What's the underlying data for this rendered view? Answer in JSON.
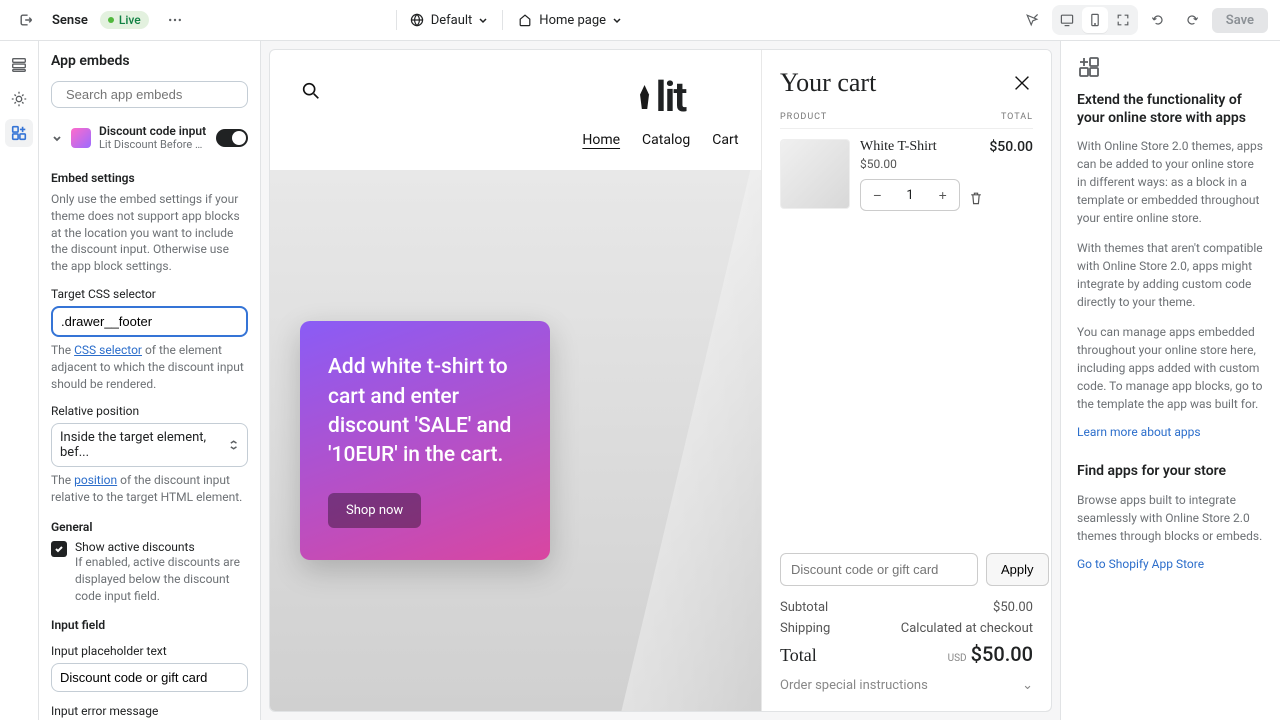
{
  "topbar": {
    "store_name": "Sense",
    "live_label": "Live",
    "page_select_label": "Default",
    "page_nav_label": "Home page",
    "save_label": "Save"
  },
  "sidebar": {
    "title": "App embeds",
    "search_placeholder": "Search app embeds",
    "app": {
      "title": "Discount code input",
      "subtitle": "Lit Discount Before C..."
    },
    "embed": {
      "section": "Embed settings",
      "help": "Only use the embed settings if your theme does not support app blocks at the location you want to include the discount input. Otherwise use the app block settings.",
      "target_label": "Target CSS selector",
      "target_value": ".drawer__footer",
      "target_help_pre": "The ",
      "target_help_link": "CSS selector",
      "target_help_post": " of the element adjacent to which the discount input should be rendered.",
      "rel_label": "Relative position",
      "rel_value": "Inside the target element, bef...",
      "rel_help_pre": "The ",
      "rel_help_link": "position",
      "rel_help_post": " of the discount input relative to the target HTML element."
    },
    "general": {
      "section": "General",
      "show_active_label": "Show active discounts",
      "show_active_help": "If enabled, active discounts are displayed below the discount code input field."
    },
    "input_field": {
      "section": "Input field",
      "placeholder_label": "Input placeholder text",
      "placeholder_value": "Discount code or gift card",
      "error_label": "Input error message"
    }
  },
  "store": {
    "nav": {
      "home": "Home",
      "catalog": "Catalog",
      "cart": "Cart"
    },
    "promo_text": "Add white t-shirt to cart and enter discount 'SALE' and '10EUR' in the cart.",
    "shop_now": "Shop now"
  },
  "cart": {
    "title": "Your cart",
    "col_product": "PRODUCT",
    "col_total": "TOTAL",
    "item": {
      "name": "White T-Shirt",
      "price": "$50.00",
      "line_total": "$50.00",
      "qty": "1"
    },
    "discount_placeholder": "Discount code or gift card",
    "apply": "Apply",
    "subtotal_label": "Subtotal",
    "subtotal_value": "$50.00",
    "shipping_label": "Shipping",
    "shipping_value": "Calculated at checkout",
    "total_label": "Total",
    "total_currency": "USD",
    "total_value": "$50.00",
    "special": "Order special instructions"
  },
  "rpanel": {
    "h1": "Extend the functionality of your online store with apps",
    "p1": "With Online Store 2.0 themes, apps can be added to your online store in different ways: as a block in a template or embedded throughout your entire online store.",
    "p2": "With themes that aren't compatible with Online Store 2.0, apps might integrate by adding custom code directly to your theme.",
    "p3": "You can manage apps embedded throughout your online store here, including apps added with custom code. To manage app blocks, go to the template the app was built for.",
    "link1": "Learn more about apps",
    "h2": "Find apps for your store",
    "p4": "Browse apps built to integrate seamlessly with Online Store 2.0 themes through blocks or embeds.",
    "link2": "Go to Shopify App Store"
  }
}
